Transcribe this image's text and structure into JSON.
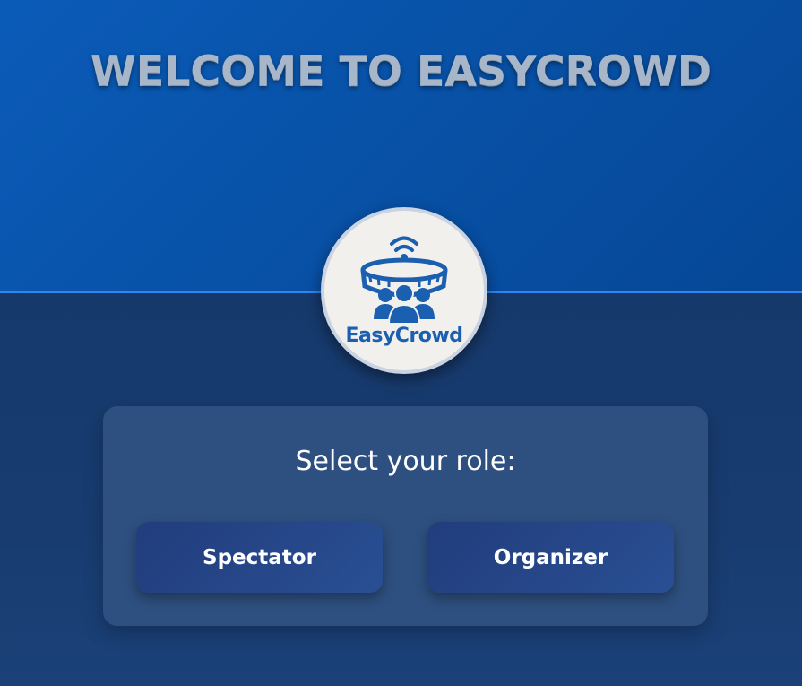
{
  "hero": {
    "title": "WELCOME TO EASYCROWD"
  },
  "logo": {
    "text": "EasyCrowd",
    "icon": "stadium-crowd-wifi-icon"
  },
  "role_selection": {
    "heading": "Select your role:",
    "buttons": [
      {
        "label": "Spectator"
      },
      {
        "label": "Organizer"
      }
    ]
  },
  "colors": {
    "hero_blue": "#0852a8",
    "divider_blue": "#2e86f0",
    "lower_navy": "#173a6c",
    "card": "#2e5080",
    "button": "#233f7e",
    "logo_blue": "#1a5fb0",
    "logo_bg": "#f2f0ec"
  }
}
